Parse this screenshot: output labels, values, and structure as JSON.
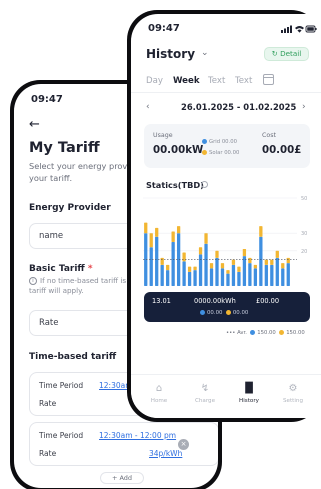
{
  "tariff_screen": {
    "status_time": "09:47",
    "title": "My Tariff",
    "subtitle": "Select your energy provi your tariff.",
    "energy_provider_label": "Energy Provider",
    "provider_placeholder": "name",
    "basic_tariff_label": "Basic Tariff",
    "required_mark": "*",
    "info_text": "If no time-based tariff is base tariff will apply.",
    "rate_placeholder": "Rate",
    "time_based_label": "Time-based tariff",
    "periods": [
      {
        "time_label": "Time Period",
        "time_value": "12:30am",
        "rate_label": "Rate",
        "rate_value": ""
      },
      {
        "time_label": "Time Period",
        "time_value": "12:30am - 12:00 pm",
        "rate_label": "Rate",
        "rate_value": "34p/kWh"
      }
    ],
    "add_label": "+ Add"
  },
  "history_screen": {
    "status_time": "09:47",
    "title": "History",
    "detail_button": "Detail",
    "tabs": [
      "Day",
      "Week",
      "Text",
      "Text"
    ],
    "active_tab": 1,
    "date_range": "26.01.2025 - 01.02.2025",
    "summary": {
      "usage_label": "Usage",
      "usage_value": "00.00kW",
      "grid_label": "Grid",
      "grid_value": "00.00",
      "solar_label": "Solar",
      "solar_value": "00.00",
      "cost_label": "Cost",
      "cost_value": "00.00£"
    },
    "stats_title": "Statics(TBD)",
    "tooltip": {
      "date": "13.01",
      "energy": "0000.00kWh",
      "cost": "£00.00",
      "grid_value": "00.00",
      "solar_value": "00.00"
    },
    "legend": {
      "avg_label": "Avr.",
      "grid_value": "150.00",
      "solar_value": "150.00"
    },
    "nav": [
      "Home",
      "Charge",
      "History",
      "Setting"
    ],
    "active_nav": 2
  },
  "colors": {
    "grid": "#3f8fe0",
    "solar": "#f2b632",
    "tooltip_bg": "#16203a",
    "detail_green": "#2f9e5c"
  },
  "chart_data": {
    "type": "bar",
    "title": "Statics(TBD)",
    "ylim": [
      0,
      50
    ],
    "yticks": [
      50,
      30,
      20
    ],
    "grid": true,
    "average_line": 15,
    "series": [
      {
        "name": "Grid",
        "values": [
          30,
          22,
          28,
          12,
          9,
          25,
          30,
          14,
          8,
          9,
          18,
          24,
          10,
          16,
          10,
          7,
          12,
          8,
          17,
          13,
          10,
          28,
          12,
          12,
          16,
          10,
          13
        ]
      },
      {
        "name": "Solar",
        "values": [
          6,
          8,
          5,
          4,
          3,
          6,
          4,
          5,
          3,
          2,
          4,
          6,
          3,
          4,
          3,
          2,
          3,
          3,
          4,
          3,
          2,
          6,
          3,
          3,
          4,
          3,
          3
        ]
      }
    ]
  }
}
